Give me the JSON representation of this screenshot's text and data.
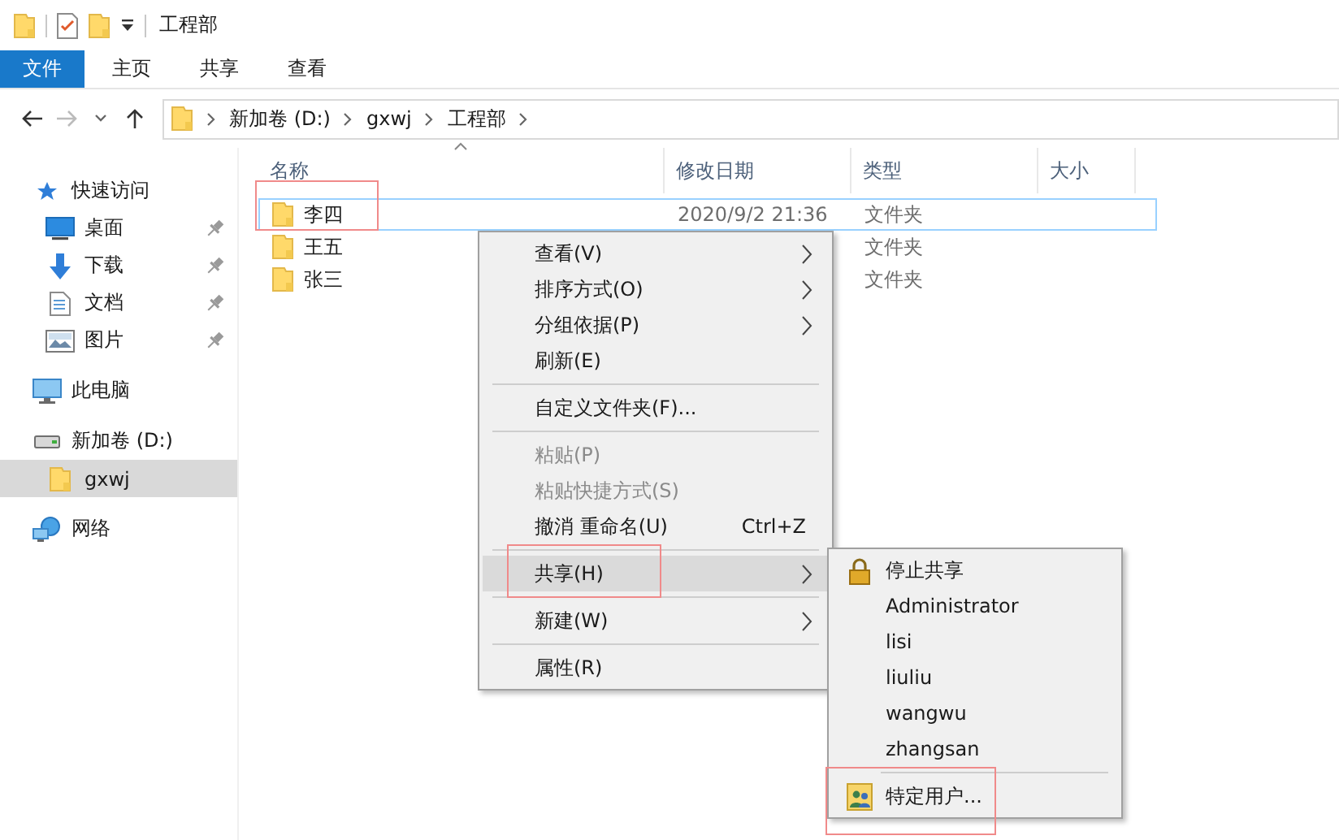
{
  "window": {
    "title": "工程部"
  },
  "ribbon_tabs": [
    {
      "label": "文件",
      "selected": true
    },
    {
      "label": "主页",
      "selected": false
    },
    {
      "label": "共享",
      "selected": false
    },
    {
      "label": "查看",
      "selected": false
    }
  ],
  "address_bar": {
    "path": [
      "新加卷 (D:)",
      "gxwj",
      "工程部"
    ]
  },
  "sidebar": {
    "items": [
      {
        "label": "快速访问",
        "kind": "star",
        "selected": false,
        "children": [
          {
            "label": "桌面",
            "kind": "desktop",
            "pinned": true,
            "selected": false
          },
          {
            "label": "下载",
            "kind": "download",
            "pinned": true,
            "selected": false
          },
          {
            "label": "文档",
            "kind": "document",
            "pinned": true,
            "selected": false
          },
          {
            "label": "图片",
            "kind": "picture",
            "pinned": true,
            "selected": false
          }
        ]
      },
      {
        "label": "此电脑",
        "kind": "computer",
        "selected": false
      },
      {
        "label": "新加卷 (D:)",
        "kind": "drive",
        "selected": false,
        "children": [
          {
            "label": "gxwj",
            "kind": "folder",
            "selected": true
          }
        ]
      },
      {
        "label": "网络",
        "kind": "network",
        "selected": false
      }
    ]
  },
  "file_list": {
    "columns": [
      "名称",
      "修改日期",
      "类型",
      "大小"
    ],
    "rows": [
      {
        "name": "李四",
        "date": "2020/9/2 21:36",
        "type": "文件夹",
        "selected": true,
        "annotated": true
      },
      {
        "name": "王五",
        "type": "文件夹",
        "selected": false,
        "annotated": false
      },
      {
        "name": "张三",
        "type": "文件夹",
        "selected": false,
        "annotated": false
      }
    ]
  },
  "context_menu": {
    "items": [
      {
        "kind": "item",
        "label": "查看(V)",
        "has_submenu": true,
        "disabled": false,
        "selected": false,
        "annotated": false
      },
      {
        "kind": "item",
        "label": "排序方式(O)",
        "has_submenu": true,
        "disabled": false,
        "selected": false,
        "annotated": false
      },
      {
        "kind": "item",
        "label": "分组依据(P)",
        "has_submenu": true,
        "disabled": false,
        "selected": false,
        "annotated": false
      },
      {
        "kind": "item",
        "label": "刷新(E)",
        "has_submenu": false,
        "disabled": false,
        "selected": false,
        "annotated": false
      },
      {
        "kind": "separator"
      },
      {
        "kind": "item",
        "label": "自定义文件夹(F)...",
        "has_submenu": false,
        "disabled": false,
        "selected": false,
        "annotated": false
      },
      {
        "kind": "separator"
      },
      {
        "kind": "item",
        "label": "粘贴(P)",
        "has_submenu": false,
        "disabled": true,
        "selected": false,
        "annotated": false
      },
      {
        "kind": "item",
        "label": "粘贴快捷方式(S)",
        "has_submenu": false,
        "disabled": true,
        "selected": false,
        "annotated": false
      },
      {
        "kind": "item",
        "label": "撤消 重命名(U)",
        "shortcut": "Ctrl+Z",
        "has_submenu": false,
        "disabled": false,
        "selected": false,
        "annotated": false
      },
      {
        "kind": "separator"
      },
      {
        "kind": "item",
        "label": "共享(H)",
        "has_submenu": true,
        "disabled": false,
        "selected": true,
        "annotated": true,
        "submenu": [
          {
            "kind": "lock",
            "label": "停止共享",
            "annotated": false
          },
          {
            "kind": "plain",
            "label": "Administrator",
            "annotated": false
          },
          {
            "kind": "plain",
            "label": "lisi",
            "annotated": false
          },
          {
            "kind": "plain",
            "label": "liuliu",
            "annotated": false
          },
          {
            "kind": "plain",
            "label": "wangwu",
            "annotated": false
          },
          {
            "kind": "plain",
            "label": "zhangsan",
            "annotated": false
          },
          {
            "kind": "separator"
          },
          {
            "kind": "people",
            "label": "特定用户...",
            "annotated": true
          }
        ]
      },
      {
        "kind": "separator"
      },
      {
        "kind": "item",
        "label": "新建(W)",
        "has_submenu": true,
        "disabled": false,
        "selected": false,
        "annotated": false
      },
      {
        "kind": "separator"
      },
      {
        "kind": "item",
        "label": "属性(R)",
        "has_submenu": false,
        "disabled": false,
        "selected": false,
        "annotated": false
      }
    ]
  }
}
